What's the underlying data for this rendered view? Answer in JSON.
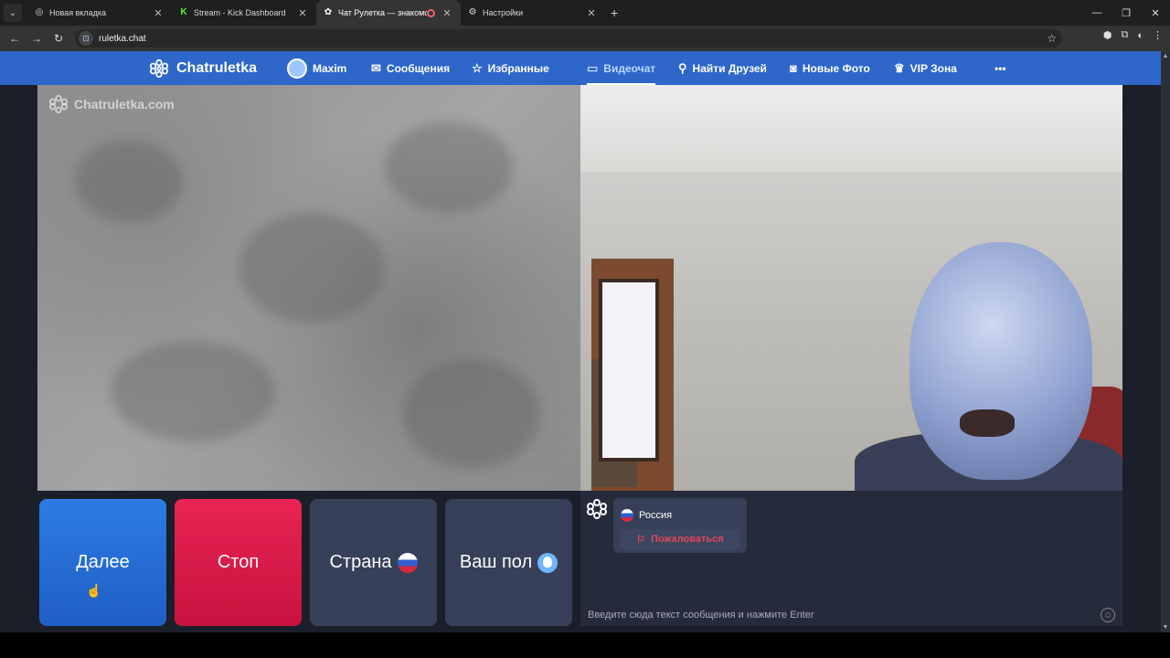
{
  "browser": {
    "tabs": [
      {
        "title": "Новая вкладка",
        "icon": "new-tab-icon"
      },
      {
        "title": "Stream - Kick Dashboard",
        "icon": "kick-icon"
      },
      {
        "title": "Чат Рулетка — знакомства",
        "icon": "chatruletka-icon",
        "recording": true
      },
      {
        "title": "Настройки",
        "icon": "settings-icon"
      }
    ],
    "url": "ruletka.chat"
  },
  "header": {
    "brand": "Chatruletka",
    "nav": {
      "user": "Maxim",
      "messages": "Сообщения",
      "favorites": "Избранные",
      "videochat": "Видеочат",
      "find_friends": "Найти Друзей",
      "new_photos": "Новые Фото",
      "vip": "VIP Зона",
      "more": "•••"
    },
    "accent_color": "#2e67c9"
  },
  "video": {
    "watermark": "Chatruletka.com"
  },
  "controls": {
    "next": "Далее",
    "stop": "Стоп",
    "country": "Страна",
    "gender": "Ваш пол"
  },
  "chat": {
    "partner_country": "Россия",
    "report": "Пожаловаться",
    "input_placeholder": "Введите сюда текст сообщения и нажмите Enter"
  }
}
